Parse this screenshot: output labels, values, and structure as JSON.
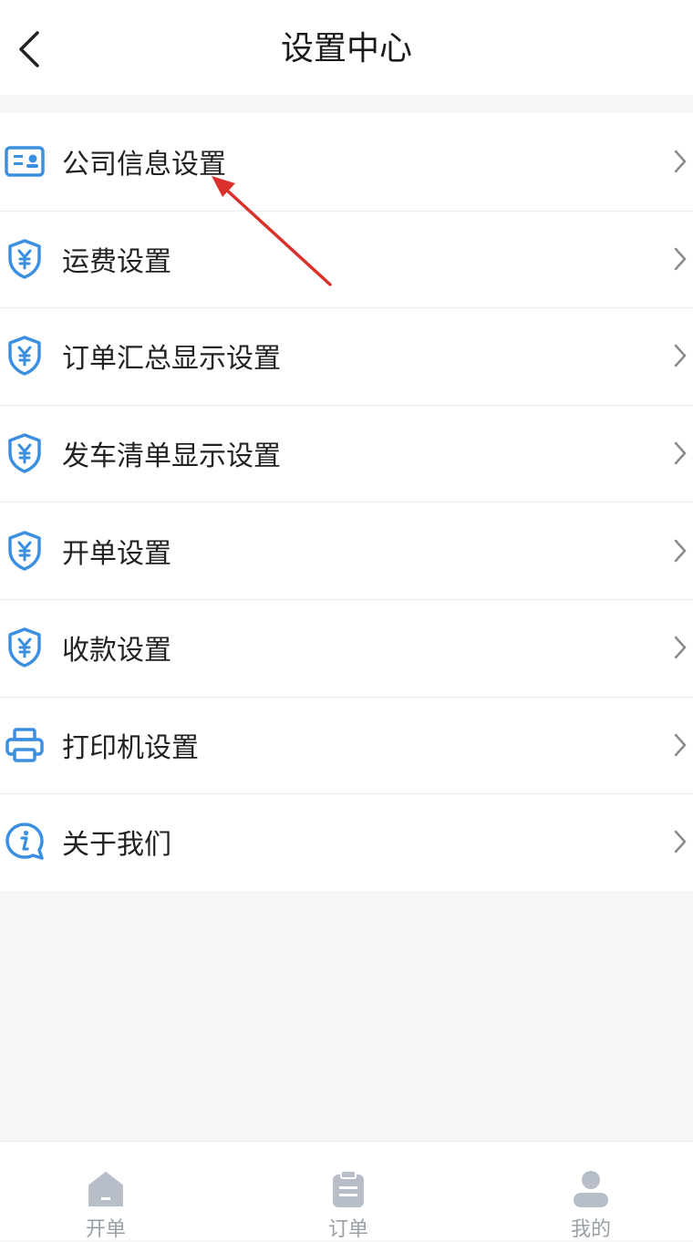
{
  "header": {
    "title": "设置中心",
    "back_icon": "back-arrow-icon"
  },
  "menu": {
    "items": [
      {
        "label": "公司信息设置",
        "icon": "id-card-icon"
      },
      {
        "label": "运费设置",
        "icon": "yuan-shield-icon"
      },
      {
        "label": "订单汇总显示设置",
        "icon": "yuan-shield-icon"
      },
      {
        "label": "发车清单显示设置",
        "icon": "yuan-shield-icon"
      },
      {
        "label": "开单设置",
        "icon": "yuan-shield-icon"
      },
      {
        "label": "收款设置",
        "icon": "yuan-shield-icon"
      },
      {
        "label": "打印机设置",
        "icon": "printer-icon"
      },
      {
        "label": "关于我们",
        "icon": "info-bubble-icon"
      }
    ]
  },
  "tabbar": {
    "tabs": [
      {
        "label": "开单",
        "icon": "home-icon"
      },
      {
        "label": "订单",
        "icon": "clipboard-icon"
      },
      {
        "label": "我的",
        "icon": "user-icon"
      }
    ]
  },
  "colors": {
    "icon_blue": "#3b8fe0",
    "annotation_red": "#d9302c",
    "tab_gray": "#b8bec7"
  }
}
